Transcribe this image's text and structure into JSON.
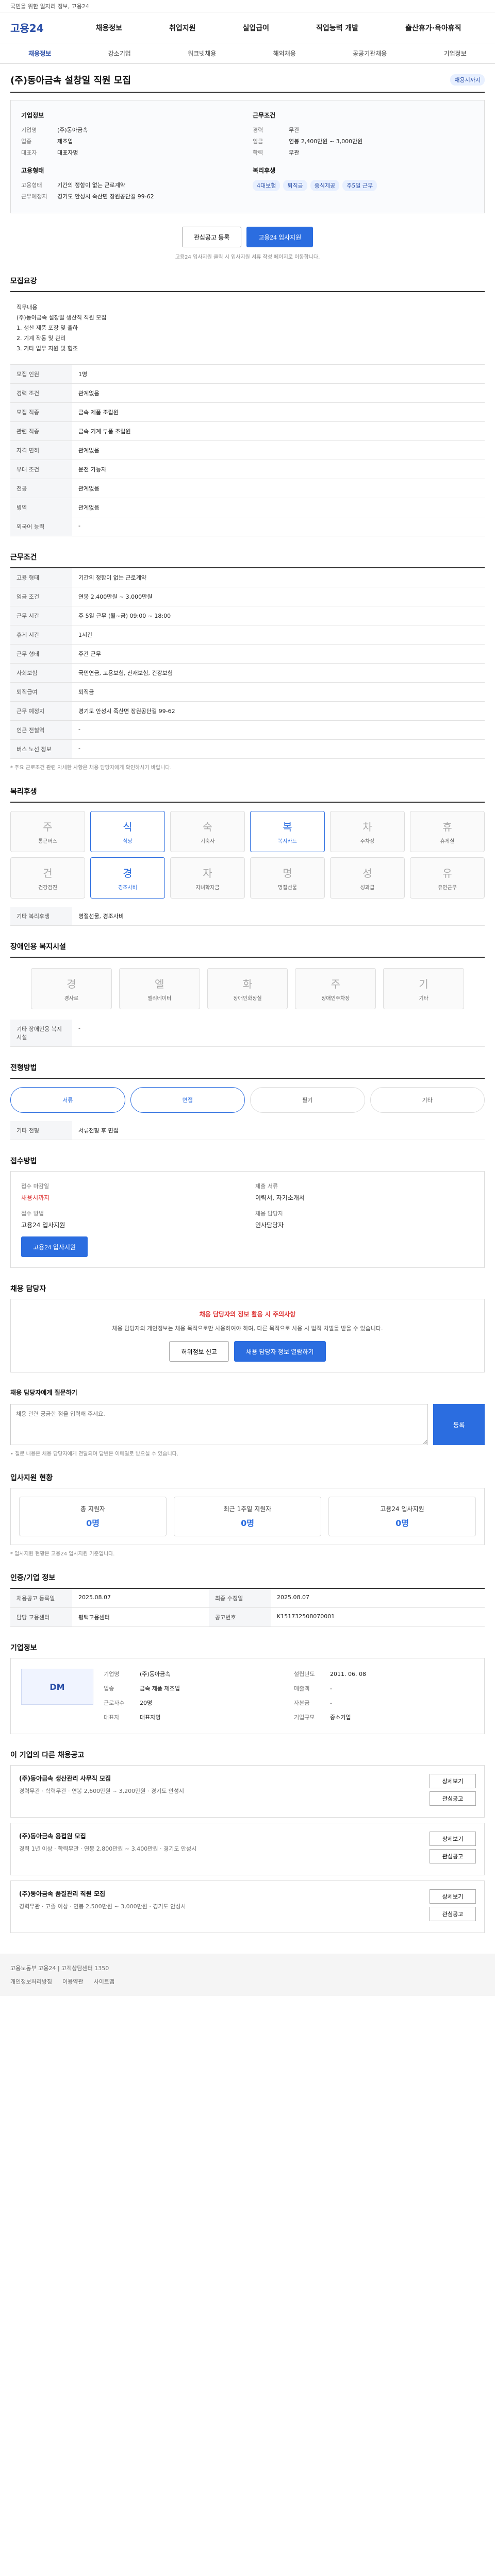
{
  "topbar": {
    "text": "국민을 위한 일자리 정보, 고용24"
  },
  "header": {
    "logo": "고용24",
    "gnb": [
      "채용정보",
      "취업지원",
      "실업급여",
      "직업능력 개발",
      "출산휴가·육아휴직"
    ]
  },
  "subnav": {
    "items": [
      "채용정보",
      "강소기업",
      "워크넷채용",
      "해외채용",
      "공공기관채용",
      "기업정보"
    ],
    "active_index": 0
  },
  "job": {
    "title": "(주)동아금속 설창일 직원 모집",
    "badge": "채용시까지",
    "company": {
      "label": "기업정보",
      "rows": [
        {
          "k": "기업명",
          "v": "(주)동아금속"
        },
        {
          "k": "업종",
          "v": "제조업"
        },
        {
          "k": "대표자",
          "v": "대표자명"
        }
      ],
      "worker_label": "고용형태",
      "worker_rows": [
        {
          "k": "고용형태",
          "v": "기간의 정함이 없는 근로계약"
        },
        {
          "k": "근무예정지",
          "v": "경기도 안성시 죽산면 장원공단길 99-62"
        }
      ]
    },
    "cond": {
      "label": "근무조건",
      "rows": [
        {
          "k": "경력",
          "v": "무관"
        },
        {
          "k": "임금",
          "v": "연봉 2,400만원 ~ 3,000만원"
        },
        {
          "k": "학력",
          "v": "무관"
        }
      ],
      "tags_label": "복리후생",
      "tags": [
        "4대보험",
        "퇴직금",
        "중식제공",
        "주5일 근무"
      ]
    }
  },
  "actions": {
    "scrap": "관심공고 등록",
    "apply": "고용24 입사지원"
  },
  "notice": "고용24 입사지원 클릭 시 입사지원 서류 작성 페이지로 이동합니다.",
  "sections": {
    "recruit": {
      "title": "모집요강",
      "desc": "직무내용\n(주)동아금속 설창일 생산직 직원 모집\n1. 생산 제품 포장 및 출하\n2. 기계 작동 및 관리\n3. 기타 업무 지원 및 협조",
      "rows": [
        {
          "k": "모집 인원",
          "v": "1명"
        },
        {
          "k": "경력 조건",
          "v": "관계없음"
        },
        {
          "k": "모집 직종",
          "v": "금속 제품 조립원"
        },
        {
          "k": "관련 직종",
          "v": "금속 기계 부품 조립원"
        },
        {
          "k": "자격 면허",
          "v": "관계없음"
        },
        {
          "k": "우대 조건",
          "v": "운전 가능자"
        },
        {
          "k": "전공",
          "v": "관계없음"
        },
        {
          "k": "병역",
          "v": "관계없음"
        },
        {
          "k": "외국어 능력",
          "v": "-"
        }
      ]
    },
    "work": {
      "title": "근무조건",
      "rows": [
        {
          "k": "고용 형태",
          "v": "기간의 정함이 없는 근로계약"
        },
        {
          "k": "임금 조건",
          "v": "연봉 2,400만원 ~ 3,000만원"
        },
        {
          "k": "근무 시간",
          "v": "주 5일 근무 (월~금) 09:00 ~ 18:00"
        },
        {
          "k": "휴게 시간",
          "v": "1시간"
        },
        {
          "k": "근무 형태",
          "v": "주간 근무"
        },
        {
          "k": "사회보험",
          "v": "국민연금, 고용보험, 산재보험, 건강보험"
        },
        {
          "k": "퇴직급여",
          "v": "퇴직금"
        },
        {
          "k": "근무 예정지",
          "v": "경기도 안성시 죽산면 장원공단길 99-62"
        },
        {
          "k": "인근 전철역",
          "v": "-"
        },
        {
          "k": "버스 노선 정보",
          "v": "-"
        }
      ],
      "footnote": "* 주요 근로조건 관련 자세한 사항은 채용 담당자에게 확인하시기 바랍니다."
    },
    "welfare": {
      "title": "복리후생",
      "tiles": [
        {
          "icon": "주",
          "label": "통근버스",
          "on": false
        },
        {
          "icon": "식",
          "label": "식당",
          "on": true
        },
        {
          "icon": "숙",
          "label": "기숙사",
          "on": false
        },
        {
          "icon": "복",
          "label": "복지카드",
          "on": true
        },
        {
          "icon": "차",
          "label": "주차장",
          "on": false
        },
        {
          "icon": "휴",
          "label": "휴게실",
          "on": false
        },
        {
          "icon": "건",
          "label": "건강검진",
          "on": false
        },
        {
          "icon": "경",
          "label": "경조사비",
          "on": true
        },
        {
          "icon": "자",
          "label": "자녀학자금",
          "on": false
        },
        {
          "icon": "명",
          "label": "명절선물",
          "on": false
        },
        {
          "icon": "성",
          "label": "성과급",
          "on": false
        },
        {
          "icon": "유",
          "label": "유연근무",
          "on": false
        }
      ],
      "extra_label": "기타 복리후생",
      "extra": "명절선물, 경조사비"
    },
    "disability": {
      "title": "장애인용 복지시설",
      "tiles": [
        {
          "icon": "경",
          "label": "경사로",
          "on": false
        },
        {
          "icon": "엘",
          "label": "엘리베이터",
          "on": false
        },
        {
          "icon": "화",
          "label": "장애인화장실",
          "on": false
        },
        {
          "icon": "주",
          "label": "장애인주차장",
          "on": false
        },
        {
          "icon": "기",
          "label": "기타",
          "on": false
        }
      ],
      "extra_label": "기타 장애인용 복지시설",
      "extra": "-"
    },
    "screen": {
      "title": "전형방법",
      "steps": [
        "서류",
        "면접",
        "필기",
        "기타"
      ],
      "active": [
        true,
        true,
        false,
        false
      ],
      "rows": [
        {
          "k": "기타 전형",
          "v": "서류전형 후 면접"
        }
      ]
    },
    "apply": {
      "title": "접수방법",
      "period_label": "접수 마감일",
      "period": "채용시까지",
      "method_label": "접수 방법",
      "method": "고용24 입사지원",
      "doc_label": "제출 서류",
      "doc": "이력서, 자기소개서",
      "contact_label": "채용 담당자",
      "contact": "인사담당자",
      "button": "고용24 입사지원"
    },
    "warning": {
      "title": "채용 담당자",
      "head": "채용 담당자의 정보 활용 시 주의사항",
      "body": "채용 담당자의 개인정보는 채용 목적으로만 사용하여야 하며, 다른 목적으로 사용 시 법적 처벌을 받을 수 있습니다.",
      "btn1": "허위정보 신고",
      "btn2": "채용 담당자 정보 열람하기"
    },
    "report": {
      "title": "채용 담당자에게 질문하기",
      "placeholder": "채용 관련 궁금한 점을 입력해 주세요.",
      "button": "등록",
      "notes": "• 질문 내용은 채용 담당자에게 전달되며 답변은 이메일로 받으실 수 있습니다."
    },
    "stats": {
      "title": "입사지원 현황",
      "items": [
        {
          "label": "총 지원자",
          "n": "0명"
        },
        {
          "label": "최근 1주일 지원자",
          "n": "0명"
        },
        {
          "label": "고용24 입사지원",
          "n": "0명"
        }
      ],
      "note": "* 입사지원 현황은 고용24 입사지원 기준입니다."
    },
    "info": {
      "title": "인증/기업 정보",
      "rows": [
        {
          "k": "채용공고 등록일",
          "v": "2025.08.07"
        },
        {
          "k": "최종 수정일",
          "v": "2025.08.07"
        },
        {
          "k": "담당 고용센터",
          "v": "평택고용센터"
        },
        {
          "k": "공고번호",
          "v": "K151732508070001"
        }
      ]
    },
    "company": {
      "title": "기업정보",
      "logo": "DM",
      "rows": [
        {
          "k": "기업명",
          "v": "(주)동아금속"
        },
        {
          "k": "설립년도",
          "v": "2011. 06. 08"
        },
        {
          "k": "업종",
          "v": "금속 제품 제조업"
        },
        {
          "k": "매출액",
          "v": "-"
        },
        {
          "k": "근로자수",
          "v": "20명"
        },
        {
          "k": "자본금",
          "v": "-"
        },
        {
          "k": "대표자",
          "v": "대표자명"
        },
        {
          "k": "기업규모",
          "v": "중소기업"
        }
      ]
    },
    "others": {
      "title": "이 기업의 다른 채용공고",
      "jobs": [
        {
          "title": "(주)동아금속 생산관리 사무직 모집",
          "meta": "경력무관 · 학력무관 · 연봉 2,600만원 ~ 3,200만원 · 경기도 안성시",
          "btn1": "상세보기",
          "btn2": "관심공고"
        },
        {
          "title": "(주)동아금속 용접원 모집",
          "meta": "경력 1년 이상 · 학력무관 · 연봉 2,800만원 ~ 3,400만원 · 경기도 안성시",
          "btn1": "상세보기",
          "btn2": "관심공고"
        },
        {
          "title": "(주)동아금속 품질관리 직원 모집",
          "meta": "경력무관 · 고졸 이상 · 연봉 2,500만원 ~ 3,000만원 · 경기도 안성시",
          "btn1": "상세보기",
          "btn2": "관심공고"
        }
      ]
    }
  },
  "footer": {
    "text": "고용노동부 고용24 | 고객상담센터 1350",
    "links": [
      "개인정보처리방침",
      "이용약관",
      "사이트맵"
    ]
  }
}
